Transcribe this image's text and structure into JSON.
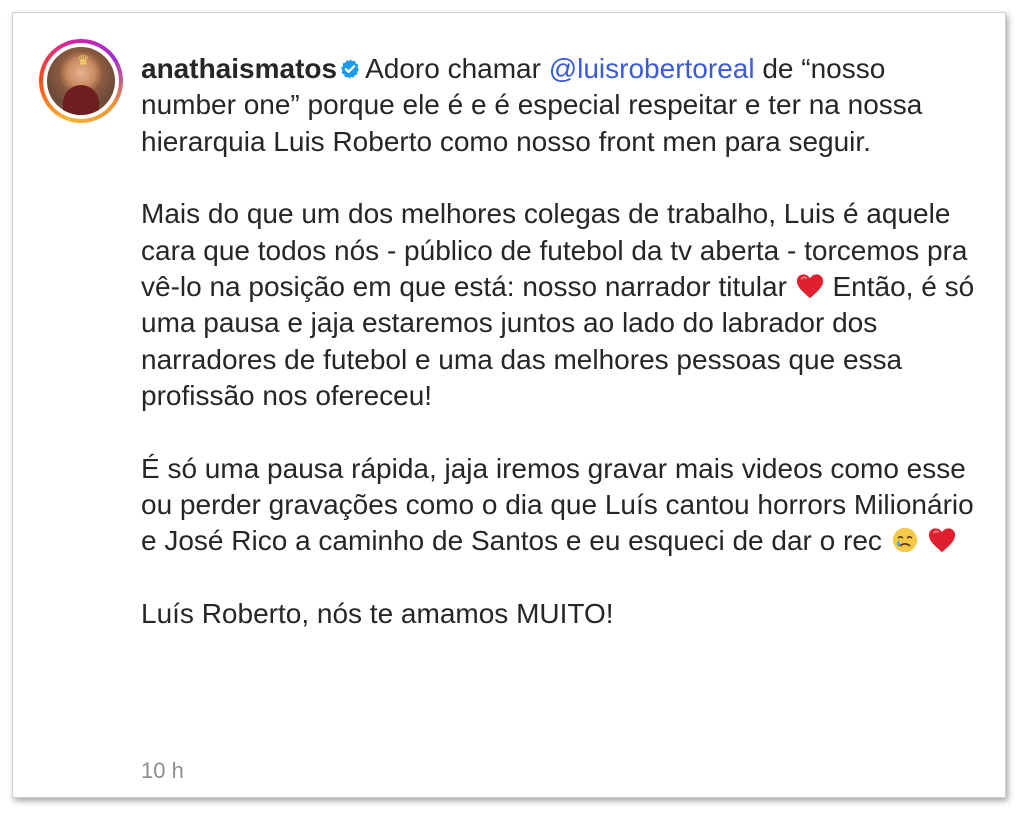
{
  "post": {
    "username": "anathaismatos",
    "caption_start": "Adoro chamar ",
    "mention": "@luisrobertoreal",
    "caption_after_mention": " de “nosso number one” porque ele é e é especial respeitar e ter na nossa hierarquia Luis Roberto como nosso front men para seguir.",
    "p2_before_heart": "Mais do que um dos melhores colegas de trabalho, Luis é aquele cara que todos nós - público de futebol da tv aberta - torcemos pra vê-lo na posição em que está: nosso narrador titular ",
    "p2_after_heart": " Então, é só uma pausa e jaja estaremos juntos ao lado do labrador dos narradores de futebol e uma das melhores pessoas que essa profissão nos ofereceu!",
    "p3_text": "É só uma pausa rápida, jaja iremos gravar mais videos como esse ou perder gravações como o dia que Luís cantou horrors Milionário e José Rico a caminho de Santos e eu esqueci de dar o rec ",
    "p4_text": "Luís Roberto, nós te amamos MUITO!",
    "timestamp": "10 h"
  },
  "icons": {
    "verified": "verified-badge-icon",
    "heart": "red-heart-emoji",
    "crying": "smiling-face-with-tear-emoji"
  },
  "colors": {
    "mention": "#3b5bdb",
    "verified": "#1d9bf0",
    "heart": "#e0202e",
    "text": "#262626",
    "timestamp": "#8e8e8e"
  }
}
